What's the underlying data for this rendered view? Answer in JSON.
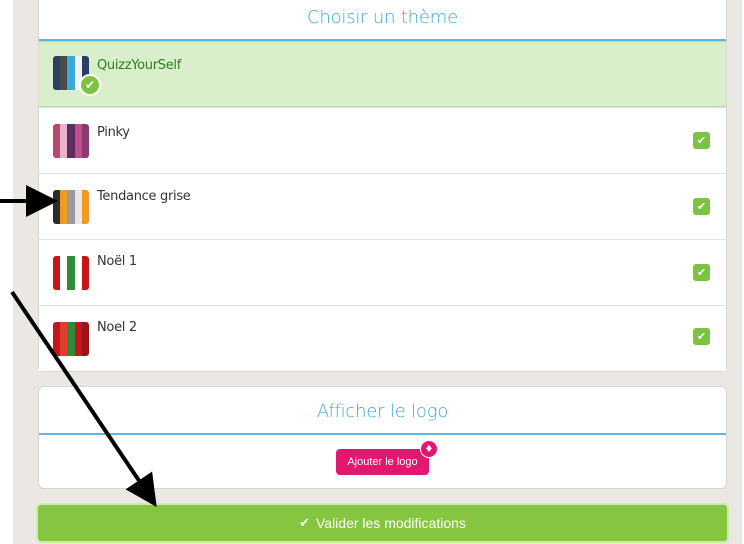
{
  "theme_panel": {
    "title": "Choisir un thème",
    "themes": [
      {
        "name": "QuizzYourSelf",
        "selected": true,
        "colors": [
          "#2b3e66",
          "#4a4a4a",
          "#3aa8d8",
          "#f2f2f2",
          "#2b3e66"
        ]
      },
      {
        "name": "Pinky",
        "selected": false,
        "colors": [
          "#b7476e",
          "#e6b3c8",
          "#5b2d63",
          "#c24f8a",
          "#8a3b74"
        ]
      },
      {
        "name": "Tendance grise",
        "selected": false,
        "colors": [
          "#2b2b2b",
          "#f09a1e",
          "#9a9a9a",
          "#e8e8e8",
          "#f09a1e"
        ]
      },
      {
        "name": "Noël 1",
        "selected": false,
        "colors": [
          "#c4161c",
          "#ffffff",
          "#2e8b3a",
          "#ffffff",
          "#c4161c"
        ]
      },
      {
        "name": "Noel 2",
        "selected": false,
        "colors": [
          "#c4161c",
          "#e23d2e",
          "#2e8b3a",
          "#c4161c",
          "#a01219"
        ]
      }
    ]
  },
  "logo_panel": {
    "title": "Afficher le logo",
    "add_button": "Ajouter le logo"
  },
  "footer": {
    "validate_label": "Valider les modifications"
  },
  "icons": {
    "check": "✔",
    "gem": "♦"
  },
  "colors": {
    "accent_blue": "#3aa8d8",
    "green": "#7cc243",
    "pink": "#e2176e"
  }
}
